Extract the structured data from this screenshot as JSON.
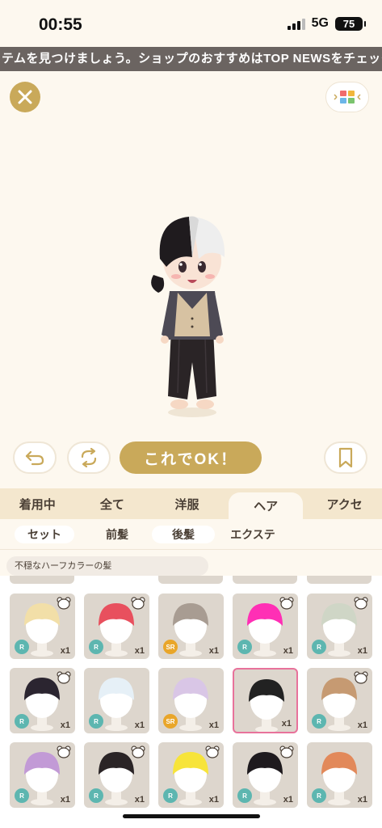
{
  "status": {
    "time": "00:55",
    "network": "5G",
    "battery": "75"
  },
  "ticker": {
    "text": "テムを見つけましょう。ショップのおすすめはTOP NEWSをチェック"
  },
  "icons": {
    "close": "close-icon",
    "view_toggle": "color-grid-icon",
    "undo": "undo-icon",
    "rotate": "rotate-icon",
    "bookmark": "bookmark-icon",
    "bear": "bear-icon"
  },
  "colors": {
    "accent": "#c9a95a",
    "tab_bg": "#f4e7ce",
    "selected_border": "#e8729b",
    "rarity_r": "#5db6b0",
    "rarity_sr": "#e9a62a"
  },
  "actions": {
    "ok_label": "これでOK！"
  },
  "category_tabs": [
    {
      "label": "着用中",
      "active": false
    },
    {
      "label": "全て",
      "active": false
    },
    {
      "label": "洋服",
      "active": false
    },
    {
      "label": "ヘア",
      "active": true
    },
    {
      "label": "アクセ",
      "active": false
    }
  ],
  "sub_tabs": [
    {
      "label": "セット",
      "active": false
    },
    {
      "label": "前髪",
      "active": true
    },
    {
      "label": "後髪",
      "active": false
    },
    {
      "label": "エクステ",
      "active": false
    }
  ],
  "filter": {
    "label": "不穏なハーフカラーの髪"
  },
  "items": [
    {
      "hair": "#f2dfa8",
      "rarity": "R",
      "qty": "x1",
      "bear": true,
      "selected": false
    },
    {
      "hair": "#e8505e",
      "rarity": "R",
      "qty": "x1",
      "bear": true,
      "selected": false
    },
    {
      "hair": "#a89c92",
      "rarity": "SR",
      "qty": "x1",
      "bear": false,
      "selected": false
    },
    {
      "hair": "#ff2fb5",
      "rarity": "R",
      "qty": "x1",
      "bear": true,
      "selected": false
    },
    {
      "hair": "#cfd6c6",
      "rarity": "R",
      "qty": "x1",
      "bear": true,
      "selected": false
    },
    {
      "hair": "#2b2530",
      "rarity": "R",
      "qty": "x1",
      "bear": true,
      "selected": false
    },
    {
      "hair": "#e6f0f7",
      "rarity": "R",
      "qty": "x1",
      "bear": false,
      "selected": false
    },
    {
      "hair": "#d9c6e6",
      "rarity": "SR",
      "qty": "x1",
      "bear": false,
      "selected": false
    },
    {
      "hair": "#222222",
      "rarity": "",
      "qty": "x1",
      "bear": false,
      "selected": true
    },
    {
      "hair": "#c69a72",
      "rarity": "R",
      "qty": "x1",
      "bear": true,
      "selected": false
    },
    {
      "hair": "#c29ad6",
      "rarity": "R",
      "qty": "x1",
      "bear": true,
      "selected": false
    },
    {
      "hair": "#2a2426",
      "rarity": "R",
      "qty": "x1",
      "bear": true,
      "selected": false
    },
    {
      "hair": "#f7e43a",
      "rarity": "R",
      "qty": "x1",
      "bear": true,
      "selected": false
    },
    {
      "hair": "#1e1a1e",
      "rarity": "R",
      "qty": "x1",
      "bear": true,
      "selected": false
    },
    {
      "hair": "#e2895a",
      "rarity": "R",
      "qty": "x1",
      "bear": false,
      "selected": false
    }
  ]
}
